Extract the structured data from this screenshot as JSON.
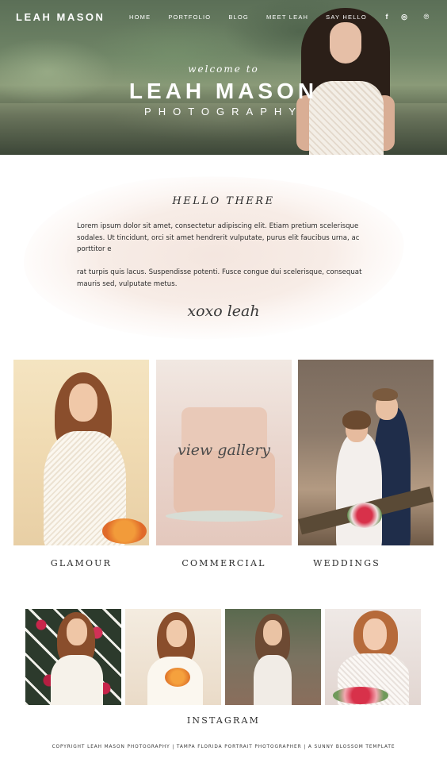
{
  "header": {
    "logo": "LEAH MASON",
    "nav": [
      "HOME",
      "PORTFOLIO",
      "BLOG",
      "MEET LEAH",
      "SAY HELLO"
    ],
    "social": [
      {
        "name": "facebook-icon",
        "glyph": "f"
      },
      {
        "name": "instagram-icon",
        "glyph": "◎"
      },
      {
        "name": "pinterest-icon",
        "glyph": "℗"
      }
    ]
  },
  "hero": {
    "welcome": "welcome to",
    "title": "LEAH MASON",
    "subtitle": "PHOTOGRAPHY"
  },
  "intro": {
    "heading": "HELLO THERE",
    "paragraph1": "Lorem ipsum dolor sit amet, consectetur adipiscing elit. Etiam pretium scelerisque sodales. Ut tincidunt, orci sit amet hendrerit vulputate, purus elit faucibus urna, ac porttitor e",
    "paragraph2": "rat turpis quis lacus. Suspendisse potenti. Fusce congue dui scelerisque, consequat mauris sed, vulputate metus.",
    "signature": "xoxo leah"
  },
  "gallery": {
    "overlay": "view gallery",
    "items": [
      "GLAMOUR",
      "COMMERCIAL",
      "WEDDINGS"
    ]
  },
  "instagram": {
    "title": "INSTAGRAM"
  },
  "footer": {
    "text": "COPYRIGHT LEAH MASON PHOTOGRAPHY | TAMPA FLORIDA PORTRAIT PHOTOGRAPHER | A SUNNY BLOSSOM TEMPLATE"
  },
  "colors": {
    "accent_blush": "#f4e6df",
    "text": "#2d2d2d"
  }
}
